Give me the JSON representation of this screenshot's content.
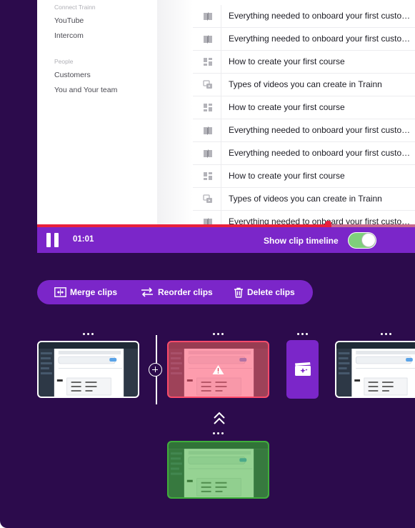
{
  "sidebar": {
    "sections": [
      {
        "title": "Connect Trainn",
        "items": [
          "YouTube",
          "Intercom"
        ]
      },
      {
        "title": "People",
        "items": [
          "Customers",
          "You and Your team"
        ]
      }
    ]
  },
  "content_rows": [
    {
      "icon": "book-icon",
      "title": "Everything needed to onboard your first customer"
    },
    {
      "icon": "book-icon",
      "title": "Everything needed to onboard your first customer"
    },
    {
      "icon": "grid-icon",
      "title": "How to create your first course"
    },
    {
      "icon": "video-icon",
      "title": "Types of videos you can create in Trainn"
    },
    {
      "icon": "grid-icon",
      "title": "How to create your first course"
    },
    {
      "icon": "book-icon",
      "title": "Everything needed to onboard your first customer"
    },
    {
      "icon": "book-icon",
      "title": "Everything needed to onboard your first customer"
    },
    {
      "icon": "grid-icon",
      "title": "How to create your first course"
    },
    {
      "icon": "video-icon",
      "title": "Types of videos you can create in Trainn"
    },
    {
      "icon": "book-icon",
      "title": "Everything needed to onboard your first customer"
    }
  ],
  "player": {
    "time": "01:01",
    "progress_fraction": 0.77,
    "show_clip_timeline_label": "Show clip timeline",
    "show_clip_timeline_on": true
  },
  "clip_actions": {
    "merge": "Merge clips",
    "reorder": "Reorder clips",
    "delete": "Delete clips"
  },
  "colors": {
    "background": "#2c0b4c",
    "accent": "#7b26c9",
    "progress": "#e8203c",
    "toggle_on": "#7fd07b",
    "clip_warning": "#fb4a6a",
    "clip_selected": "#3fae3a"
  }
}
